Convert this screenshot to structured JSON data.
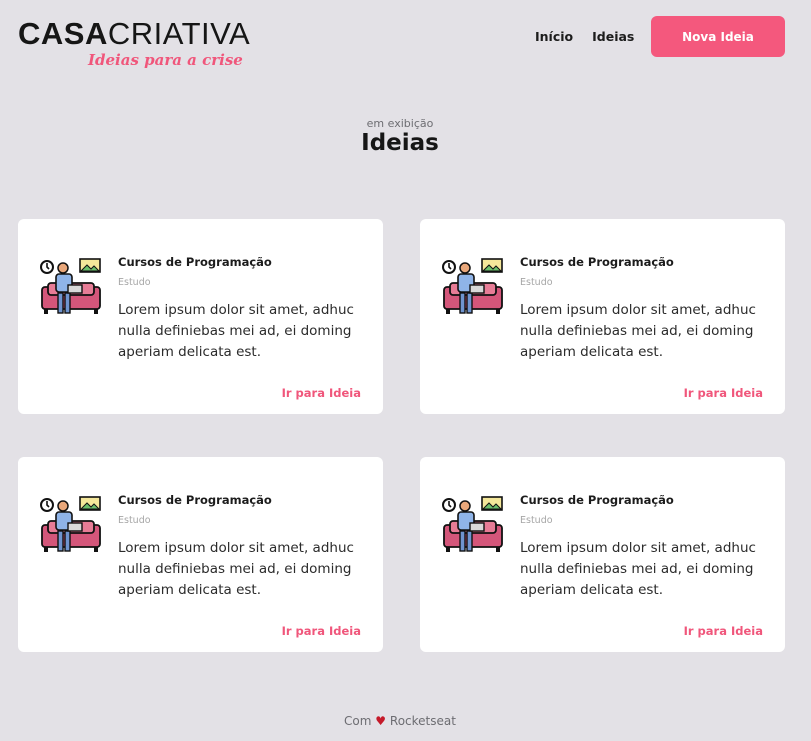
{
  "header": {
    "logo_bold": "CASA",
    "logo_light": "CRIATIVA",
    "tagline": "Ideias para a crise",
    "nav": [
      "Início",
      "Ideias"
    ],
    "new_button": "Nova Ideia"
  },
  "section": {
    "subtitle": "em exibição",
    "title": "Ideias"
  },
  "cards": [
    {
      "title": "Cursos de Programação",
      "category": "Estudo",
      "description": "Lorem ipsum dolor sit amet, adhuc nulla definiebas mei ad, ei doming aperiam delicata est.",
      "link": "Ir para Ideia"
    },
    {
      "title": "Cursos de Programação",
      "category": "Estudo",
      "description": "Lorem ipsum dolor sit amet, adhuc nulla definiebas mei ad, ei doming aperiam delicata est.",
      "link": "Ir para Ideia"
    },
    {
      "title": "Cursos de Programação",
      "category": "Estudo",
      "description": "Lorem ipsum dolor sit amet, adhuc nulla definiebas mei ad, ei doming aperiam delicata est.",
      "link": "Ir para Ideia"
    },
    {
      "title": "Cursos de Programação",
      "category": "Estudo",
      "description": "Lorem ipsum dolor sit amet, adhuc nulla definiebas mei ad, ei doming aperiam delicata est.",
      "link": "Ir para Ideia"
    }
  ],
  "footer": {
    "prefix": "Com",
    "heart": "♥",
    "brand": "Rocketseat"
  },
  "colors": {
    "accent": "#f4587d",
    "background": "#e3e1e6"
  },
  "icons": {
    "card_illustration": "person-on-sofa-with-laptop-icon"
  }
}
